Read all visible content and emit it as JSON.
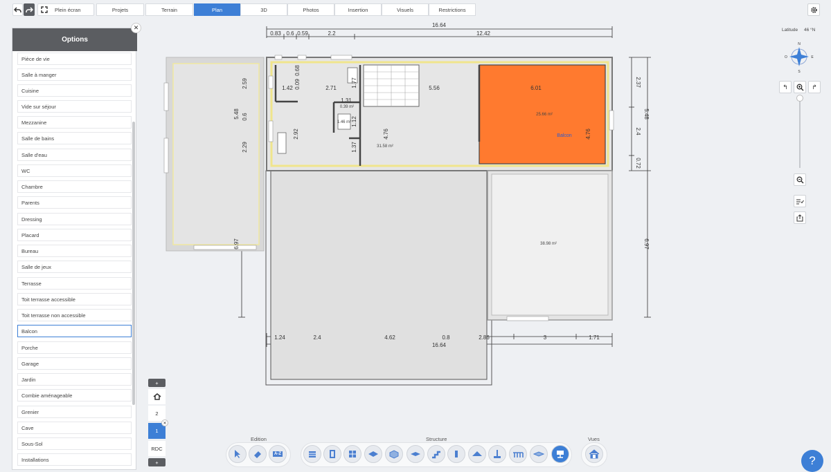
{
  "toolbar": {
    "fullscreen_label": "Plein écran",
    "tabs": [
      "Projets",
      "Terrain",
      "Plan",
      "3D",
      "Photos",
      "Insertion",
      "Visuels",
      "Restrictions"
    ],
    "active_tab": "Plan"
  },
  "options_panel": {
    "title": "Options",
    "items": [
      "Pièce de vie",
      "Salle à manger",
      "Cuisine",
      "Vide sur séjour",
      "Mezzanine",
      "Salle de bains",
      "Salle d'eau",
      "WC",
      "Chambre",
      "Parents",
      "Dressing",
      "Placard",
      "Bureau",
      "Salle de jeux",
      "Terrasse",
      "Toit terrasse accessible",
      "Toit terrasse non accessible",
      "Balcon",
      "Porche",
      "Garage",
      "Jardin",
      "Combie aménageable",
      "Grenier",
      "Cave",
      "Sous-Sol",
      "Installations"
    ],
    "selected": "Balcon"
  },
  "levels": {
    "add_label": "+",
    "items": [
      "2",
      "1",
      "RDC"
    ],
    "active": "1"
  },
  "bottom_toolbar": {
    "groups": [
      "Edition",
      "Structure",
      "Vues"
    ],
    "az_label": "A-Z"
  },
  "right_panel": {
    "latitude_label": "Latitude",
    "latitude_value": "46",
    "latitude_unit": "°N",
    "compass": {
      "n": "N",
      "s": "S",
      "e": "E",
      "o": "O"
    }
  },
  "plan": {
    "top_dims_total": "16.64",
    "top_dims": [
      "0.83",
      "0.6",
      "0.59",
      "2.2",
      "12.42"
    ],
    "bottom_dims": [
      "1.24",
      "2.4",
      "4.62",
      "0.8",
      "2.86",
      "3",
      "1.71"
    ],
    "bottom_total": "16.64",
    "right_dims": [
      "2.37",
      "2.4",
      "0.72",
      "5.48",
      "6.97"
    ],
    "left_dims": [
      "2.59",
      "0.6",
      "2.29",
      "5.48",
      "6.97"
    ],
    "inner_dims": [
      "1.42",
      "0.09",
      "0.68",
      "2.71",
      "1.77",
      "5.56",
      "6.01",
      "1.31",
      "1.12",
      "2.92",
      "4.76",
      "1.37",
      "4.76"
    ],
    "areas": [
      "0.39 m²",
      "1.46 m²",
      "31.58 m²",
      "25.66 m²",
      "38.98 m²"
    ],
    "balcony_label": "Balcon"
  },
  "colors": {
    "accent": "#3d7fd6",
    "balcony": "#ff7a2f",
    "header": "#5b5d61"
  }
}
